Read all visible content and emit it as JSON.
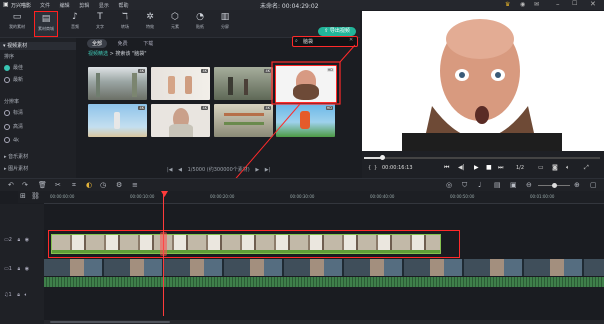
{
  "app": {
    "name": "万兴喵影",
    "menu": [
      "文件",
      "编辑",
      "剪辑",
      "显示",
      "帮助"
    ],
    "project_title": "未命名: 00:04:29:02",
    "export_label": "导出视频"
  },
  "toolbar": {
    "items": [
      {
        "label": "我的素材",
        "icon": "folder-icon"
      },
      {
        "label": "素材商城",
        "icon": "media-library-icon"
      },
      {
        "label": "音频",
        "icon": "music-icon"
      },
      {
        "label": "文字",
        "icon": "text-icon"
      },
      {
        "label": "转场",
        "icon": "transition-icon"
      },
      {
        "label": "特效",
        "icon": "effects-icon"
      },
      {
        "label": "元素",
        "icon": "element-icon"
      },
      {
        "label": "贴纸",
        "icon": "sticker-icon"
      },
      {
        "label": "分屏",
        "icon": "split-screen-icon"
      }
    ]
  },
  "left_panel": {
    "header": "视频素材",
    "sort_title": "排序",
    "sort_options": [
      "最佳",
      "最新"
    ],
    "resolution_title": "分辨率",
    "resolution_options": [
      "标清",
      "高清",
      "4k"
    ],
    "music": "音乐素材",
    "images": "图片素材"
  },
  "media": {
    "tabs": [
      "全部",
      "免费",
      "下载"
    ],
    "breadcrumb": "视频精选",
    "breadcrumb_sep": ">",
    "search_result_label": "搜索该 \"脑袋\"",
    "search_value": "脑袋",
    "pager": "1/5000 (约300000个素材)",
    "thumbnails": [
      {
        "name": "supermarket-aisle",
        "badge": "4K"
      },
      {
        "name": "hands-gesture",
        "badge": "4K"
      },
      {
        "name": "people-walking",
        "badge": "4K"
      },
      {
        "name": "bearded-man",
        "badge": "HD"
      },
      {
        "name": "person-jumping",
        "badge": "4K"
      },
      {
        "name": "surprised-woman",
        "badge": "4K"
      },
      {
        "name": "store-shelves",
        "badge": "4K"
      },
      {
        "name": "soccer-player",
        "badge": "HD"
      }
    ]
  },
  "preview": {
    "timecode": "00:00:16:13",
    "ratio": "1/2"
  },
  "timeline": {
    "ruler_marks": [
      "00:00:00:00",
      "00:00:10:00",
      "00:00:20:00",
      "00:00:30:00",
      "00:00:40:00",
      "00:00:50:00",
      "00:01:00:00"
    ],
    "tracks": [
      {
        "id": "track-2",
        "label": "2"
      },
      {
        "id": "track-1",
        "label": "1"
      },
      {
        "id": "audio-1",
        "label": "1"
      }
    ]
  },
  "colors": {
    "accent": "#23b59a",
    "highlight_red": "#ff2a2a",
    "background": "#1b1d22"
  }
}
